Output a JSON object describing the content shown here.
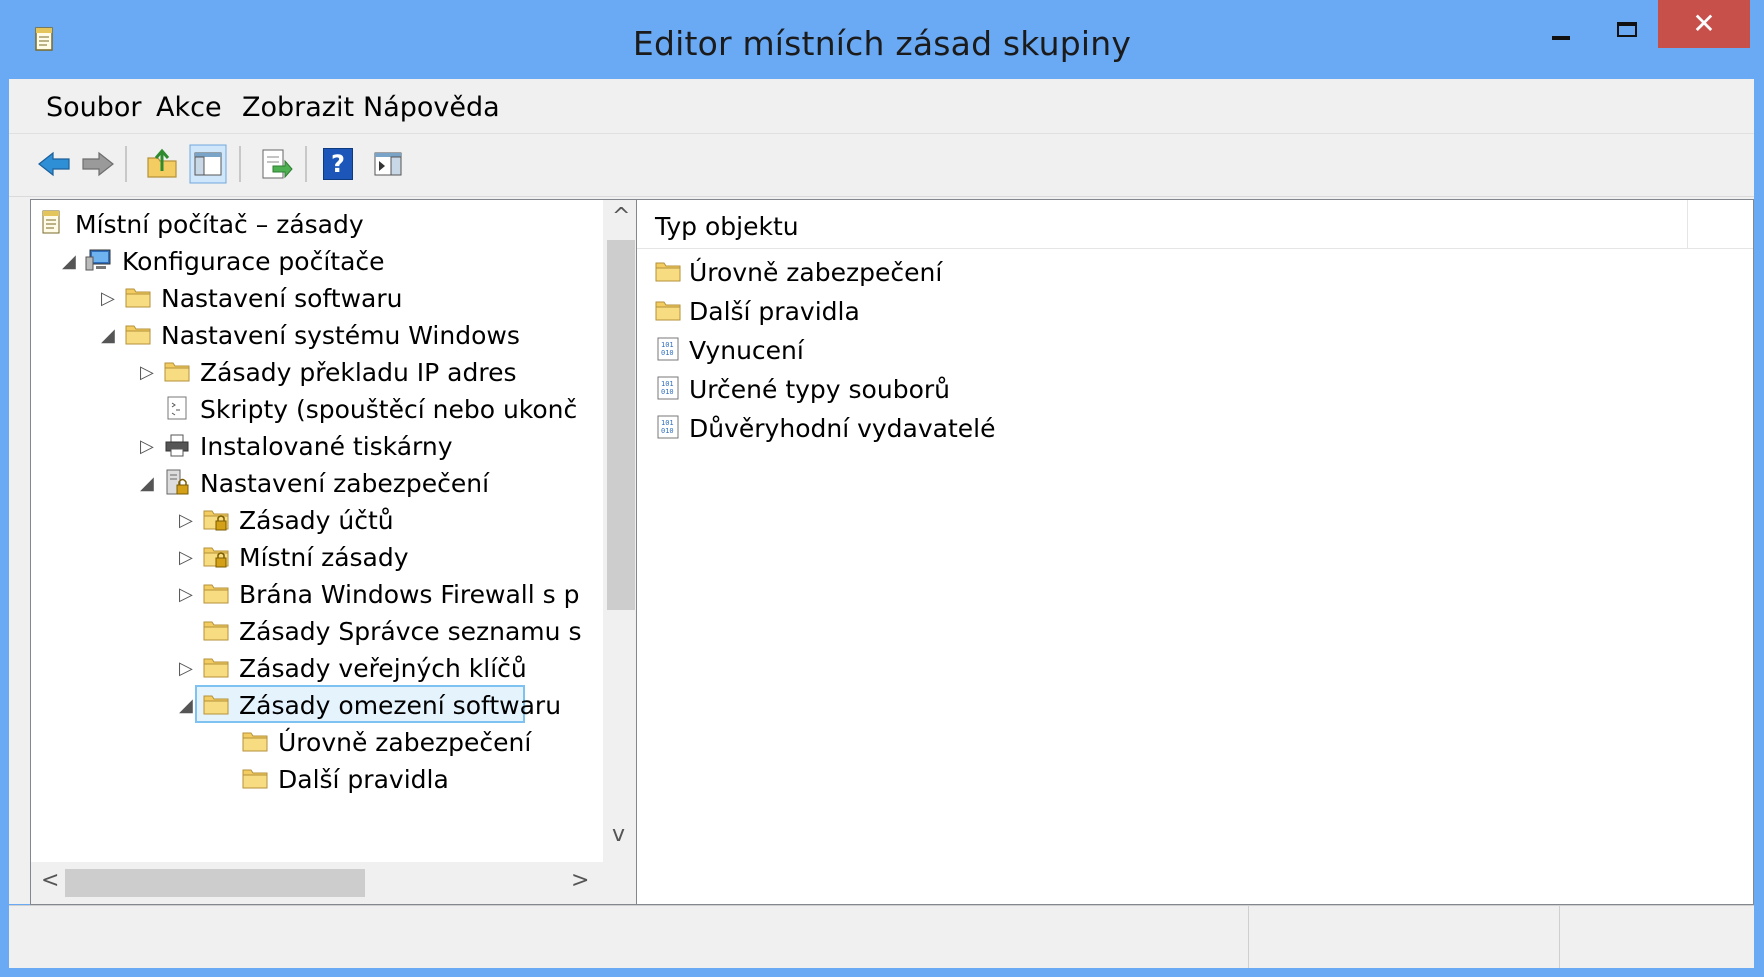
{
  "window": {
    "title": "Editor místních zásad skupiny",
    "close_glyph": "✕"
  },
  "menu": {
    "items": [
      "Soubor",
      "Akce",
      "Zobrazit",
      "Nápověda"
    ]
  },
  "toolbar": {
    "buttons": [
      "back-arrow-icon",
      "forward-arrow-icon",
      "up-folder-icon",
      "show-hide-tree-icon",
      "export-list-icon",
      "help-icon",
      "show-hide-action-pane-icon"
    ],
    "help_glyph": "?"
  },
  "tree": {
    "nodes": [
      {
        "label": "Místní počítač – zásady",
        "icon": "policy-document-icon"
      },
      {
        "label": "Konfigurace počítače",
        "icon": "computer-icon",
        "expander": "◢"
      },
      {
        "label": "Nastavení softwaru",
        "icon": "folder-icon",
        "expander": "▷"
      },
      {
        "label": "Nastavení systému Windows",
        "icon": "folder-icon",
        "expander": "◢"
      },
      {
        "label": "Zásady překladu IP adres",
        "icon": "folder-icon",
        "expander": "▷"
      },
      {
        "label": "Skripty (spouštěcí nebo ukonč",
        "icon": "script-icon"
      },
      {
        "label": "Instalované tiskárny",
        "icon": "printer-icon",
        "expander": "▷"
      },
      {
        "label": "Nastavení zabezpečení",
        "icon": "security-settings-icon",
        "expander": "◢"
      },
      {
        "label": "Zásady účtů",
        "icon": "locked-folder-icon",
        "expander": "▷"
      },
      {
        "label": "Místní zásady",
        "icon": "locked-folder-icon",
        "expander": "▷"
      },
      {
        "label": "Brána Windows Firewall s p",
        "icon": "folder-icon",
        "expander": "▷"
      },
      {
        "label": "Zásady Správce seznamu s",
        "icon": "folder-icon"
      },
      {
        "label": "Zásady veřejných klíčů",
        "icon": "folder-icon",
        "expander": "▷"
      },
      {
        "label": "Zásady omezení softwaru",
        "icon": "folder-icon",
        "expander": "◢",
        "selected": true
      },
      {
        "label": "Úrovně zabezpečení",
        "icon": "folder-icon"
      },
      {
        "label": "Další pravidla",
        "icon": "folder-icon"
      }
    ],
    "scroll_up": "^",
    "scroll_down": "v",
    "scroll_left": "<",
    "scroll_right": ">"
  },
  "list": {
    "column_header": "Typ objektu",
    "items": [
      {
        "label": "Úrovně zabezpečení",
        "icon": "folder-icon"
      },
      {
        "label": "Další pravidla",
        "icon": "folder-icon"
      },
      {
        "label": "Vynucení",
        "icon": "binary-policy-icon"
      },
      {
        "label": "Určené typy souborů",
        "icon": "binary-policy-icon"
      },
      {
        "label": "Důvěryhodní vydavatelé",
        "icon": "binary-policy-icon"
      }
    ]
  },
  "colors": {
    "titlebar": "#6aa9f4",
    "close": "#c7504b",
    "selection_border": "#7ec2f2",
    "folder": "#f3cc62"
  }
}
